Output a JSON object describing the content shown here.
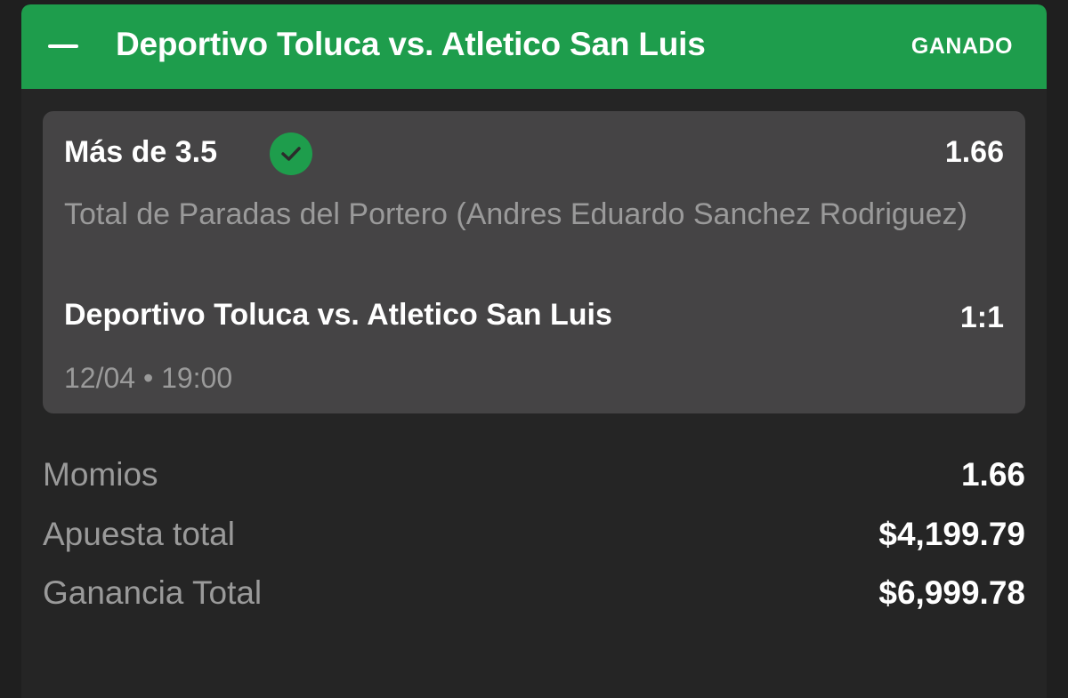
{
  "header": {
    "title": "Deportivo Toluca vs. Atletico San Luis",
    "status": "GANADO",
    "status_color": "#1e9d4c",
    "collapse_icon": "minus-icon"
  },
  "selection": {
    "pick": "Más de 3.5",
    "result_icon": "check-circle-icon",
    "odds": "1.66",
    "market": "Total de Paradas del Portero (Andres Eduardo Sanchez Rodriguez)",
    "match": "Deportivo Toluca vs. Atletico San Luis",
    "score": "1:1",
    "date": "12/04",
    "separator": "•",
    "time": "19:00"
  },
  "summary": {
    "odds_label": "Momios",
    "odds_value": "1.66",
    "stake_label": "Apuesta total",
    "stake_value": "$4,199.79",
    "payout_label": "Ganancia Total",
    "payout_value": "$6,999.78"
  }
}
